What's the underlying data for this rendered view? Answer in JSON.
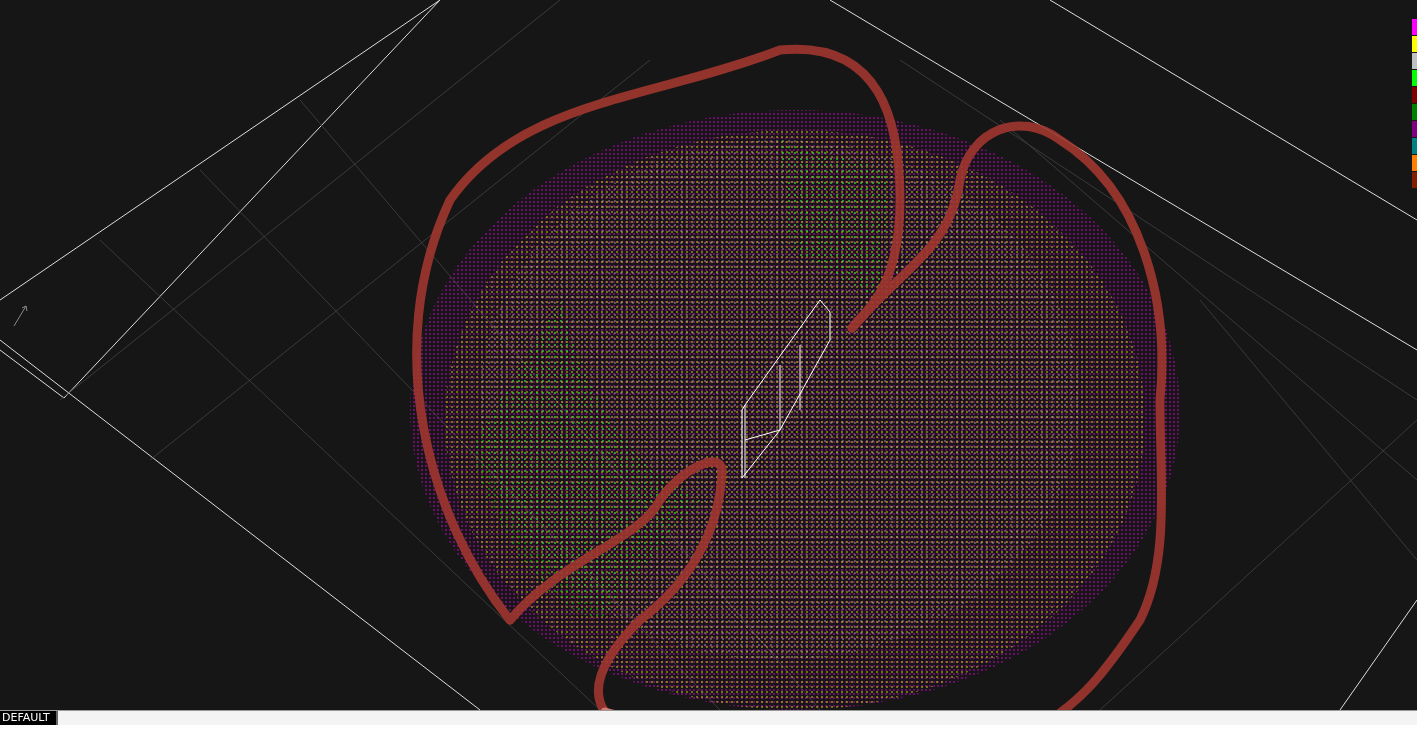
{
  "legend": [
    {
      "color": "#ff00ff"
    },
    {
      "color": "#ffff00"
    },
    {
      "color": "#c0c0c0"
    },
    {
      "color": "#00ff00"
    },
    {
      "color": "#800000"
    },
    {
      "color": "#008000"
    },
    {
      "color": "#800080"
    },
    {
      "color": "#008080"
    },
    {
      "color": "#ff8000"
    },
    {
      "color": "#802000"
    }
  ],
  "tabs": [
    {
      "label": "DEFAULT",
      "selected": true
    }
  ]
}
